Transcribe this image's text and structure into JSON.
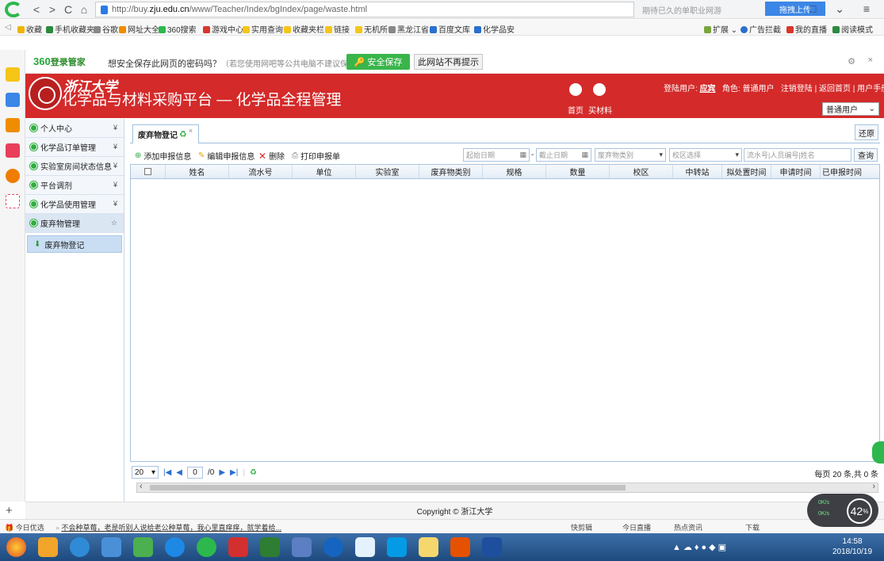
{
  "browser": {
    "url_prefix": "http://buy.",
    "url_domain": "zju.edu.cn",
    "url_path": "/www/Teacher/Index/bgIndex/page/waste.html",
    "mid_text": "期待已久的单职业网游",
    "upload_label": "拖拽上传",
    "window_controls": "□ ⌄ ≡"
  },
  "bookmarks": [
    {
      "label": "收藏 ⌄",
      "color": "#f0b400"
    },
    {
      "label": "手机收藏夹",
      "color": "#2b8a3e"
    },
    {
      "label": "谷歌",
      "color": "#888888"
    },
    {
      "label": "网址大全",
      "color": "#f08c00"
    },
    {
      "label": "360搜索",
      "color": "#2db84d"
    },
    {
      "label": "游戏中心",
      "color": "#d9362b"
    },
    {
      "label": "实用查询",
      "color": "#f5c518"
    },
    {
      "label": "收藏夹栏",
      "color": "#f5c518"
    },
    {
      "label": "链接",
      "color": "#f5c518"
    },
    {
      "label": "无机所",
      "color": "#f5c518"
    },
    {
      "label": "黑龙江省",
      "color": "#888888"
    },
    {
      "label": "百度文库",
      "color": "#2b6fd0"
    },
    {
      "label": "化学品安",
      "color": "#2b6fd0"
    }
  ],
  "bookmarks_right": [
    "扩展 ⌄",
    "广告拦截",
    "我的直播",
    "阅读模式"
  ],
  "save_prompt": {
    "brand": "360",
    "brand_suffix": "登录管家",
    "message": "想安全保存此网页的密码吗？",
    "hint": "（若您使用网吧等公共电脑不建议保存）",
    "save_label": "安全保存",
    "never_label": "此网站不再提示"
  },
  "header": {
    "university": "浙江大学",
    "system_title": "化学品与材料采购平台 — 化学品全程管理",
    "home_label": "首页",
    "buy_label": "买材料",
    "login_user_label": "登陆用户:",
    "login_user": "应宾",
    "role_label": "角色: 普通用户",
    "links": "注销登陆 | 返回首页 | 用户手册",
    "role_select": "普通用户"
  },
  "sidebar": {
    "items": [
      {
        "label": "个人中心",
        "chevron": "¥"
      },
      {
        "label": "化学品订单管理",
        "chevron": "¥"
      },
      {
        "label": "实验室房间状态信息",
        "chevron": "¥"
      },
      {
        "label": "平台调剂",
        "chevron": "¥"
      },
      {
        "label": "化学品使用管理",
        "chevron": "¥"
      },
      {
        "label": "废弃物管理",
        "chevron": "☆"
      }
    ],
    "sub_item": "废弃物登记"
  },
  "tab": {
    "label": "废弃物登记",
    "close": "×",
    "restore": "还原"
  },
  "toolbar": {
    "add": "添加申报信息",
    "edit": "编辑申报信息",
    "delete": "删除",
    "print": "打印申报单",
    "start_date": "起始日期",
    "end_date": "截止日期",
    "waste_type": "废弃物类别",
    "campus": "校区选择",
    "search_placeholder": "流水号|人员编号|姓名",
    "query": "查询"
  },
  "grid": {
    "columns": [
      "姓名",
      "流水号",
      "单位",
      "实验室",
      "废弃物类别",
      "规格",
      "数量",
      "校区",
      "中转站",
      "拟处置时间",
      "申请时间",
      "已申报时间"
    ]
  },
  "pager": {
    "page_size": "20",
    "page": "0",
    "total_pages": "/0",
    "summary": "每页 20 条,共 0 条"
  },
  "footer": {
    "copyright": "Copyright © 浙江大学"
  },
  "statusbar": {
    "today": "今日优选",
    "news": "不会种草莓，老是听别人说给老公种草莓，我心里直痒痒，就学着给...",
    "items": [
      "快剪辑",
      "今日直播",
      "热点资讯",
      "下载"
    ]
  },
  "clock": {
    "time": "14:58",
    "date": "2018/10/19"
  },
  "speed_widget": {
    "percent": "42",
    "unit": "%",
    "up": "0K/s",
    "down": "0K/s"
  },
  "colors": {
    "header_red": "#d42a2a",
    "accent_green": "#2fae3f",
    "grid_border": "#aac3de"
  }
}
